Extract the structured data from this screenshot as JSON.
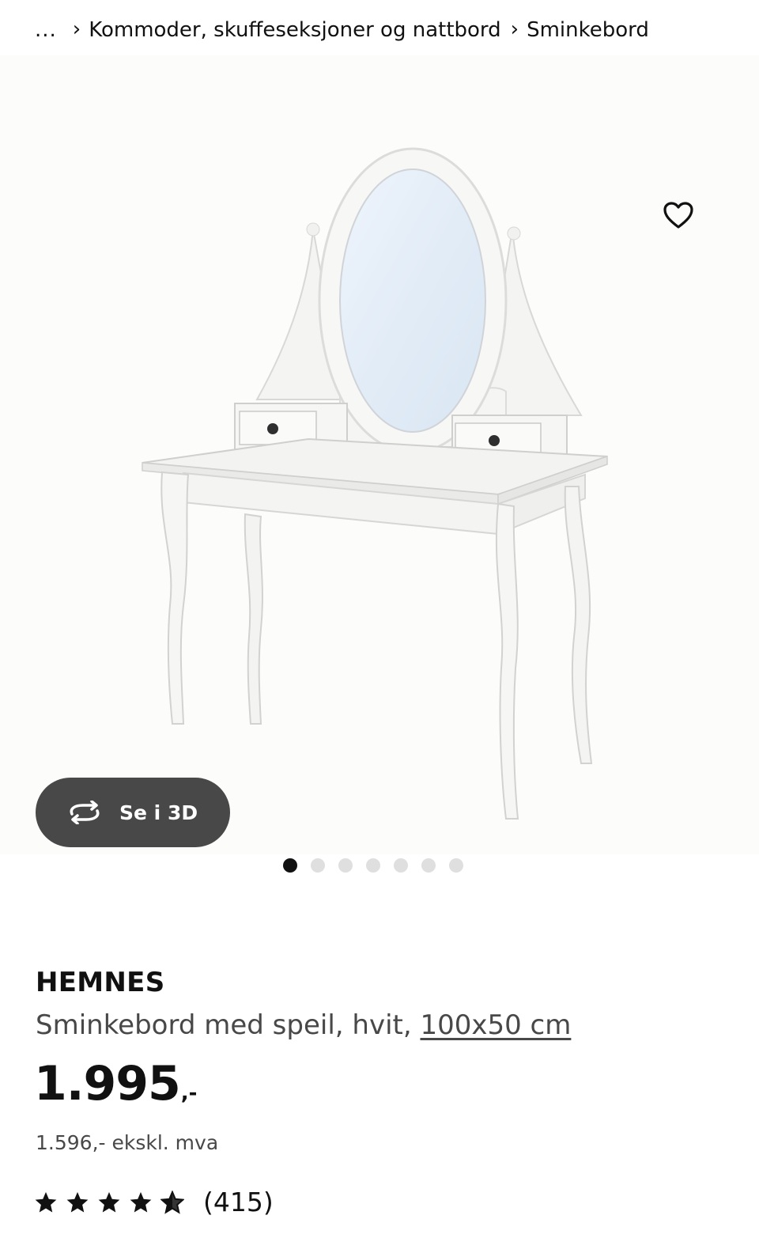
{
  "breadcrumb": {
    "ellipsis": "...",
    "items": [
      "Kommoder, skuffeseksjoner og nattbord",
      "Sminkebord"
    ]
  },
  "gallery": {
    "view3d_label": "Se i 3D",
    "image_count": 7,
    "active_index": 0
  },
  "product": {
    "brand": "HEMNES",
    "description": "Sminkebord med speil, hvit,",
    "size_link": "100x50 cm",
    "price_amount": "1.995",
    "price_suffix": ",-",
    "price_ex_vat": "1.596,- ekskl. mva",
    "rating_stars": 4.5,
    "review_count": "(415)"
  },
  "colors": {
    "text": "#111111",
    "muted": "#484848",
    "pill": "#484848",
    "dot_inactive": "#dfdfdf"
  },
  "icons": [
    "chevron-right-icon",
    "heart-icon",
    "rotate-3d-icon",
    "star-icon"
  ]
}
